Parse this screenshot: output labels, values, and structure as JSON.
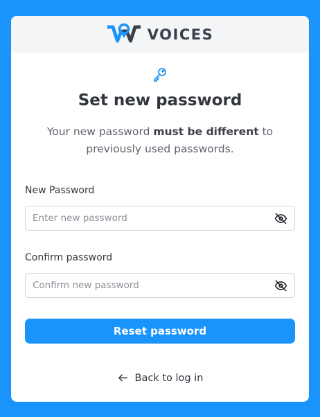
{
  "brand": {
    "name": "VOICES",
    "logo_icon": "voices-w-logo",
    "logo_color": "#1a93fb"
  },
  "header": {
    "icon": "key-icon",
    "title": "Set new password",
    "subtitle_before": "Your new password ",
    "subtitle_bold": "must be different",
    "subtitle_after": " to previously used passwords."
  },
  "form": {
    "new_password": {
      "label": "New Password",
      "placeholder": "Enter new password",
      "value": "",
      "toggle_icon": "eye-off-icon"
    },
    "confirm_password": {
      "label": "Confirm password",
      "placeholder": "Confirm new password",
      "value": "",
      "toggle_icon": "eye-off-icon"
    },
    "submit_label": "Reset password"
  },
  "footer": {
    "back_label": "Back to log in",
    "back_icon": "arrow-left-icon"
  },
  "colors": {
    "accent": "#1a93fb",
    "text_dark": "#33363f",
    "text_muted": "#5f636c"
  }
}
